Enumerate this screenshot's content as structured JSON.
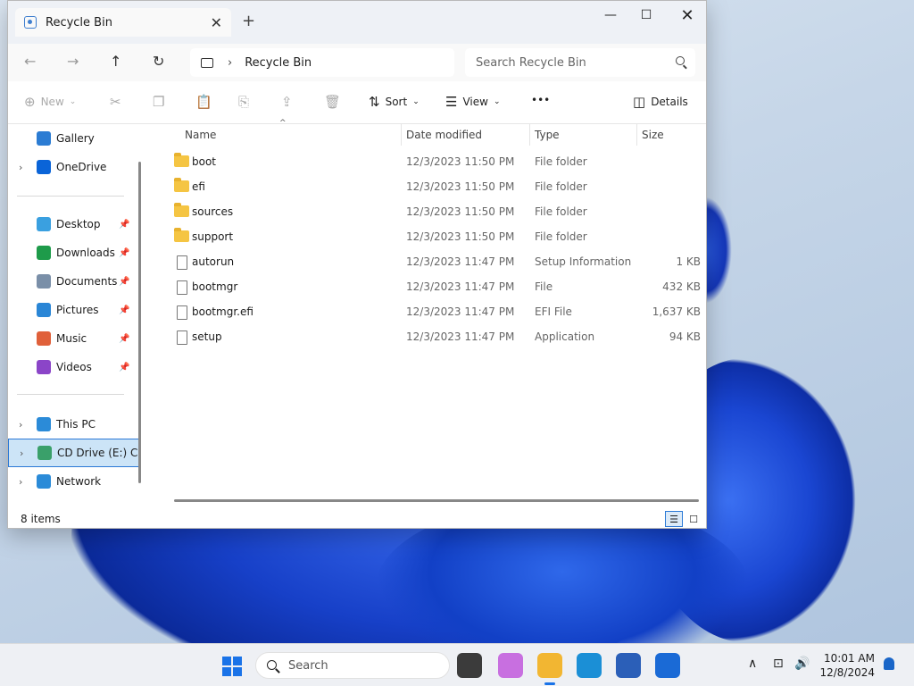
{
  "window": {
    "tab_title": "Recycle Bin",
    "min_glyph": "—",
    "max_glyph": "☐",
    "close_glyph": "✕",
    "tab_close_glyph": "✕",
    "new_tab_glyph": "+"
  },
  "address": {
    "back_glyph": "←",
    "forward_glyph": "→",
    "up_glyph": "↑",
    "refresh_glyph": "↻",
    "chevron": "›",
    "breadcrumb": "Recycle Bin",
    "search_placeholder": "Search Recycle Bin"
  },
  "commandbar": {
    "new_label": "New",
    "new_glyph": "⊕",
    "cut_glyph": "✂",
    "copy_glyph": "❐",
    "paste_glyph": "📋",
    "rename_glyph": "⎘",
    "share_glyph": "⇪",
    "delete_glyph": "🗑",
    "sort_label": "Sort",
    "sort_glyph": "⇅",
    "view_label": "View",
    "view_glyph": "☰",
    "more_glyph": "•••",
    "details_label": "Details",
    "details_glyph": "◫",
    "dropdown_glyph": "⌄"
  },
  "sidebar": {
    "items": [
      {
        "label": "Gallery",
        "pinned": false,
        "expand": false,
        "color": "#2b7cd3"
      },
      {
        "label": "OneDrive",
        "pinned": false,
        "expand": true,
        "color": "#0a64d8"
      },
      {
        "label": "Desktop",
        "pinned": true,
        "expand": false,
        "color": "#3aa0e0"
      },
      {
        "label": "Downloads",
        "pinned": true,
        "expand": false,
        "color": "#1e9b4a"
      },
      {
        "label": "Documents",
        "pinned": true,
        "expand": false,
        "color": "#7a8fa8"
      },
      {
        "label": "Pictures",
        "pinned": true,
        "expand": false,
        "color": "#2a86d6"
      },
      {
        "label": "Music",
        "pinned": true,
        "expand": false,
        "color": "#e0603a"
      },
      {
        "label": "Videos",
        "pinned": true,
        "expand": false,
        "color": "#8b45c8"
      },
      {
        "label": "This PC",
        "pinned": false,
        "expand": true,
        "color": "#2b8bd8"
      },
      {
        "label": "CD Drive (E:) CC",
        "pinned": false,
        "expand": true,
        "color": "#3aa06a"
      },
      {
        "label": "Network",
        "pinned": false,
        "expand": true,
        "color": "#2b8bd8"
      }
    ],
    "expand_glyph": "›",
    "pin_glyph": "📌"
  },
  "columns": {
    "name": "Name",
    "date": "Date modified",
    "type": "Type",
    "size": "Size",
    "sort_glyph": "^"
  },
  "files": [
    {
      "name": "boot",
      "date": "12/3/2023 11:50 PM",
      "type": "File folder",
      "size": "",
      "kind": "folder"
    },
    {
      "name": "efi",
      "date": "12/3/2023 11:50 PM",
      "type": "File folder",
      "size": "",
      "kind": "folder"
    },
    {
      "name": "sources",
      "date": "12/3/2023 11:50 PM",
      "type": "File folder",
      "size": "",
      "kind": "folder"
    },
    {
      "name": "support",
      "date": "12/3/2023 11:50 PM",
      "type": "File folder",
      "size": "",
      "kind": "folder"
    },
    {
      "name": "autorun",
      "date": "12/3/2023 11:47 PM",
      "type": "Setup Information",
      "size": "1 KB",
      "kind": "file"
    },
    {
      "name": "bootmgr",
      "date": "12/3/2023 11:47 PM",
      "type": "File",
      "size": "432 KB",
      "kind": "file"
    },
    {
      "name": "bootmgr.efi",
      "date": "12/3/2023 11:47 PM",
      "type": "EFI File",
      "size": "1,637 KB",
      "kind": "file"
    },
    {
      "name": "setup",
      "date": "12/3/2023 11:47 PM",
      "type": "Application",
      "size": "94 KB",
      "kind": "file"
    }
  ],
  "status": {
    "item_count": "8 items",
    "details_view_glyph": "☰",
    "tiles_view_glyph": "☐"
  },
  "taskbar": {
    "search_placeholder": "Search",
    "time": "10:01 AM",
    "date": "12/8/2024",
    "tray_chevron": "∧",
    "network_glyph": "⊡",
    "volume_glyph": "🔊",
    "apps": [
      {
        "name": "task-view",
        "color": "#3b3b3b"
      },
      {
        "name": "copilot",
        "color": "#c86fe0"
      },
      {
        "name": "file-explorer",
        "color": "#f2b632",
        "active": true
      },
      {
        "name": "edge",
        "color": "#1b8fd6"
      },
      {
        "name": "store",
        "color": "#2b5fb8"
      },
      {
        "name": "outlook",
        "color": "#1a6ad6"
      }
    ]
  }
}
